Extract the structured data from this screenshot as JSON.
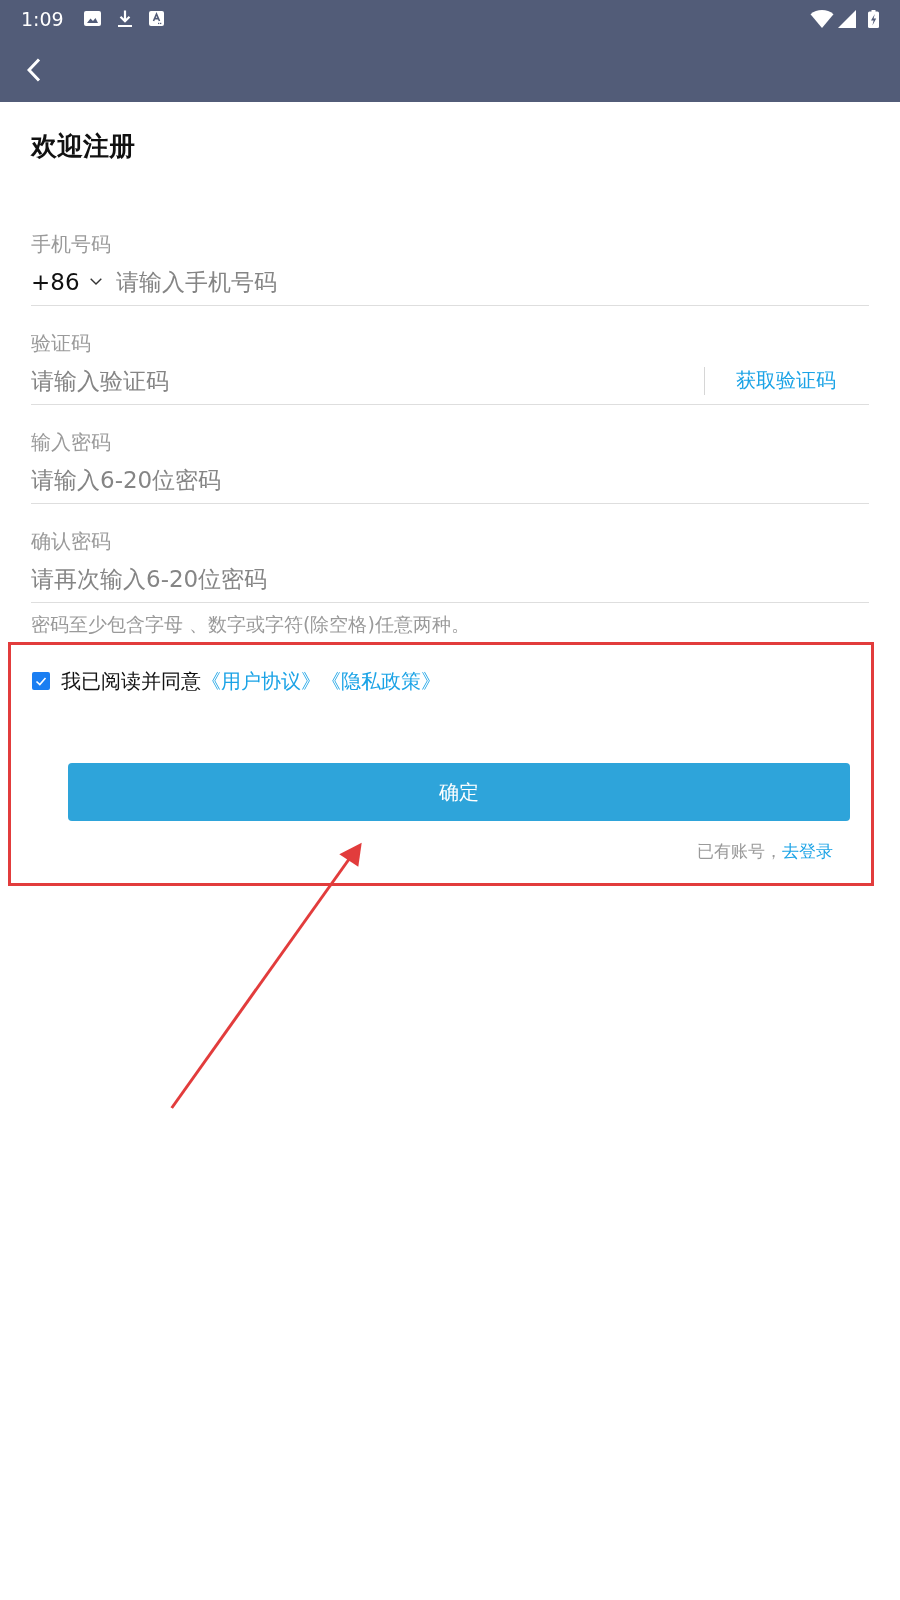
{
  "status_bar": {
    "time": "1:09"
  },
  "title": "欢迎注册",
  "fields": [
    {
      "kind": "phone",
      "label": "手机号码",
      "country_code": "+86",
      "placeholder": "请输入手机号码"
    },
    {
      "kind": "code",
      "label": "验证码",
      "placeholder": "请输入验证码",
      "action": "获取验证码"
    },
    {
      "kind": "password",
      "label": "输入密码",
      "placeholder": "请输入6-20位密码"
    },
    {
      "kind": "password",
      "label": "确认密码",
      "placeholder": "请再次输入6-20位密码"
    }
  ],
  "password_hint": "密码至少包含字母 、数字或字符(除空格)任意两种。",
  "agreement": {
    "checked": true,
    "text": "我已阅读并同意",
    "links": [
      "《用户协议》",
      "《隐私政策》"
    ]
  },
  "submit_button": "确定",
  "login_prompt": {
    "text": "已有账号，",
    "link": "去登录"
  }
}
